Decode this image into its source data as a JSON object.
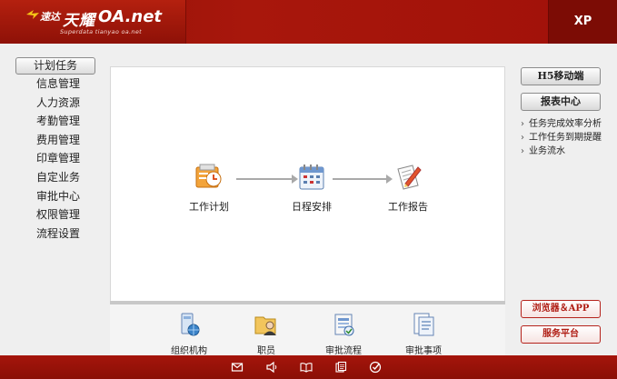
{
  "header": {
    "logo_cn_small": "速达",
    "logo_cn_big": "天耀",
    "logo_oa": "OA.net",
    "logo_sub": "Superdata tianyao oa.net",
    "edition": "XP"
  },
  "nav": {
    "selected": "计划任务",
    "items": [
      "信息管理",
      "人力资源",
      "考勤管理",
      "费用管理",
      "印章管理",
      "自定业务",
      "审批中心",
      "权限管理",
      "流程设置"
    ]
  },
  "flow": {
    "nodes": [
      {
        "label": "工作计划",
        "icon": "work-plan-icon"
      },
      {
        "label": "日程安排",
        "icon": "calendar-icon"
      },
      {
        "label": "工作报告",
        "icon": "report-icon"
      }
    ]
  },
  "bottom": {
    "items": [
      {
        "label": "组织机构",
        "icon": "org-structure-icon"
      },
      {
        "label": "职员",
        "icon": "employee-icon"
      },
      {
        "label": "审批流程",
        "icon": "approval-flow-icon"
      },
      {
        "label": "审批事项",
        "icon": "approval-items-icon"
      }
    ]
  },
  "right": {
    "h5_label": "H5移动端",
    "report_label": "报表中心",
    "links": [
      "任务完成效率分析",
      "工作任务到期提醒",
      "业务流水"
    ],
    "browser_app_label": "浏览器＆APP",
    "service_label": "服务平台"
  },
  "footer": {
    "icons": [
      "mail-icon",
      "speaker-icon",
      "book-icon",
      "copy-icon",
      "check-icon"
    ]
  },
  "colors": {
    "header": "#a1140a",
    "footer": "#960f06",
    "accent_red": "#b01e15"
  }
}
